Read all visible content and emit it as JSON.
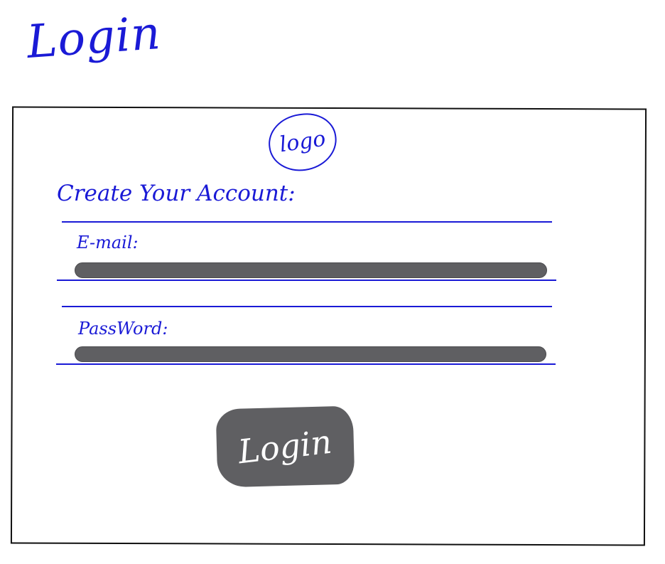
{
  "page": {
    "title": "Login"
  },
  "logo": {
    "text": "logo"
  },
  "form": {
    "heading": "Create Your Account:",
    "email": {
      "label": "E-mail:",
      "value": "",
      "placeholder": ""
    },
    "password": {
      "label": "PassWord:",
      "value": "",
      "placeholder": ""
    },
    "submit_label": "Login"
  },
  "colors": {
    "ink": "#1a1ad6",
    "field": "#5f5f62",
    "frame": "#111111",
    "background": "#ffffff"
  }
}
